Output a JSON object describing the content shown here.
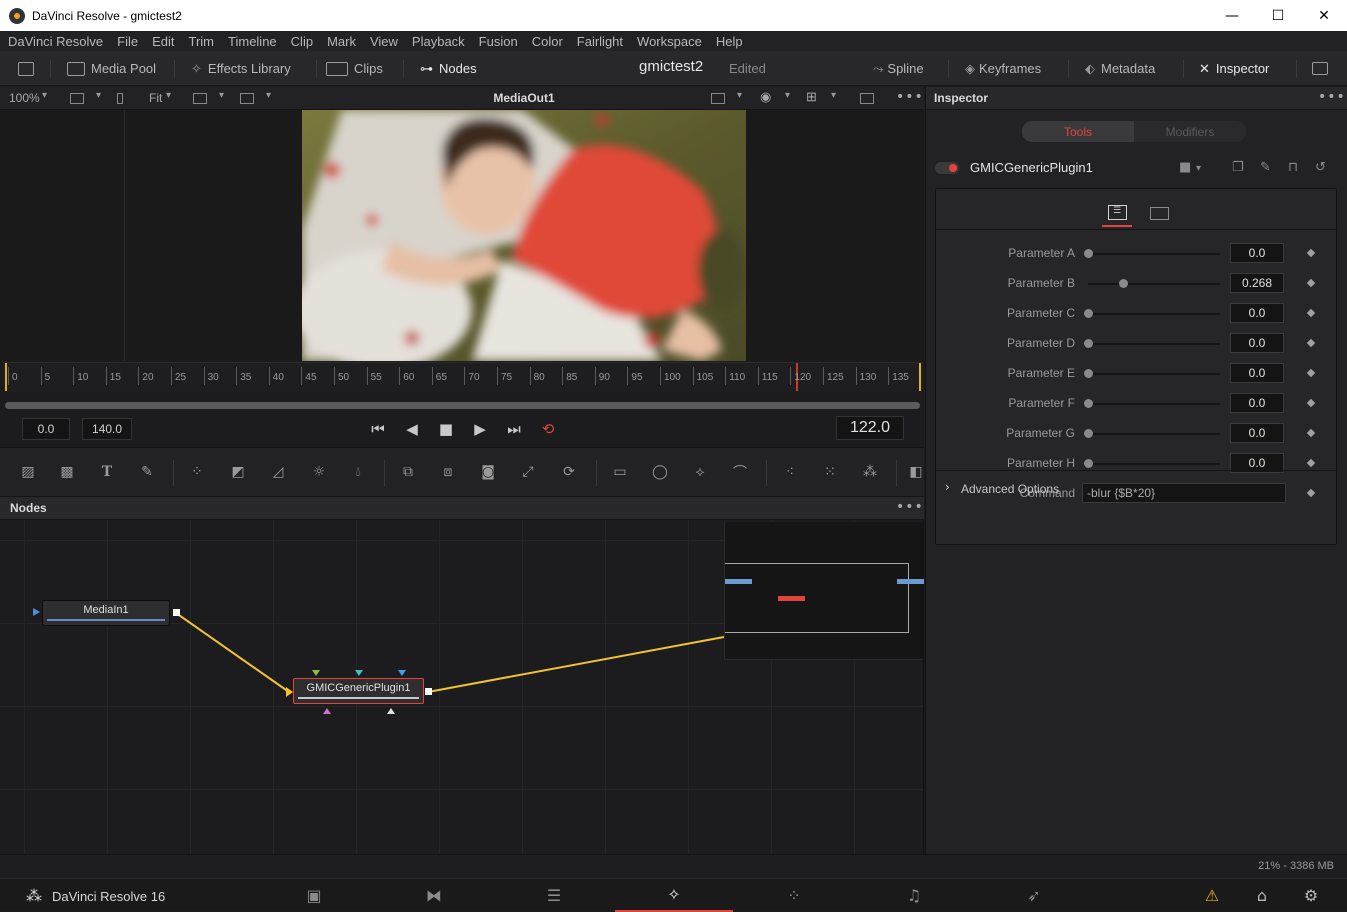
{
  "window": {
    "title": "DaVinci Resolve - gmictest2",
    "controls": {
      "minimize": "—",
      "maximize": "☐",
      "close": "✕"
    }
  },
  "menu": [
    "DaVinci Resolve",
    "File",
    "Edit",
    "Trim",
    "Timeline",
    "Clip",
    "Mark",
    "View",
    "Playback",
    "Fusion",
    "Color",
    "Fairlight",
    "Workspace",
    "Help"
  ],
  "toolbar": {
    "media_pool": "Media Pool",
    "effects_library": "Effects Library",
    "clips": "Clips",
    "nodes": "Nodes",
    "project_title": "gmictest2",
    "project_status": "Edited",
    "spline": "Spline",
    "keyframes": "Keyframes",
    "metadata": "Metadata",
    "inspector": "Inspector"
  },
  "viewer": {
    "zoom": "100%",
    "fit": "Fit",
    "name": "MediaOut1"
  },
  "ruler": {
    "ticks": [
      "0",
      "5",
      "10",
      "15",
      "20",
      "25",
      "30",
      "35",
      "40",
      "45",
      "50",
      "55",
      "60",
      "65",
      "70",
      "75",
      "80",
      "85",
      "90",
      "95",
      "100",
      "105",
      "110",
      "115",
      "120",
      "125",
      "130",
      "135"
    ]
  },
  "transport": {
    "start_time": "0.0",
    "end_time": "140.0",
    "current_frame": "122.0"
  },
  "nodes_panel": {
    "title": "Nodes",
    "nodes": [
      {
        "label": "MediaIn1"
      },
      {
        "label": "GMICGenericPlugin1"
      }
    ]
  },
  "status": {
    "memory": "21% - 3386 MB"
  },
  "pagebar": {
    "brand": "DaVinci Resolve 16"
  },
  "inspector": {
    "title": "Inspector",
    "tabs": {
      "tools": "Tools",
      "modifiers": "Modifiers"
    },
    "tool_name": "GMICGenericPlugin1",
    "parameters": [
      {
        "label": "Parameter A",
        "value": "0.0",
        "fraction": 0.0
      },
      {
        "label": "Parameter B",
        "value": "0.268",
        "fraction": 0.268
      },
      {
        "label": "Parameter C",
        "value": "0.0",
        "fraction": 0.0
      },
      {
        "label": "Parameter D",
        "value": "0.0",
        "fraction": 0.0
      },
      {
        "label": "Parameter E",
        "value": "0.0",
        "fraction": 0.0
      },
      {
        "label": "Parameter F",
        "value": "0.0",
        "fraction": 0.0
      },
      {
        "label": "Parameter G",
        "value": "0.0",
        "fraction": 0.0
      },
      {
        "label": "Parameter H",
        "value": "0.0",
        "fraction": 0.0
      }
    ],
    "command_label": "Command",
    "command_value": "-blur {$B*20}",
    "advanced_options": "Advanced Options"
  },
  "colors": {
    "accent_red": "#e2443a",
    "connection_yellow": "#f2c230",
    "node_bar_blue": "#6a8ac0"
  }
}
